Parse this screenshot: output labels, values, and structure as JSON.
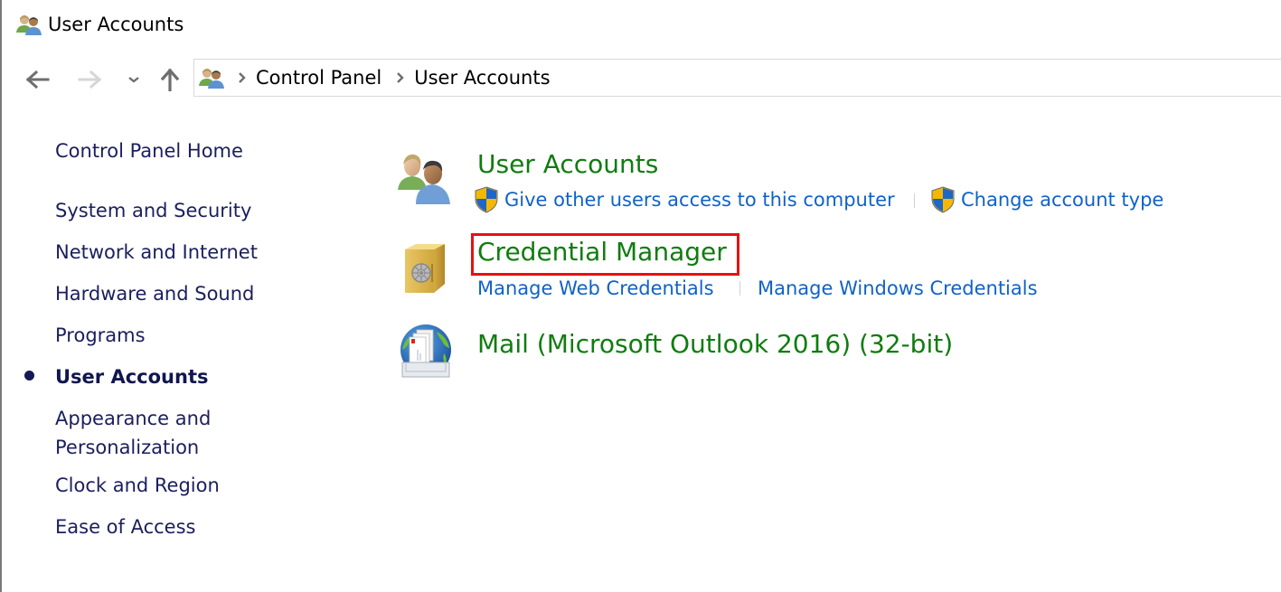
{
  "window": {
    "title": "User Accounts",
    "title_icon": "user-accounts-icon"
  },
  "navigation": {
    "back_icon": "arrow-left-icon",
    "forward_icon": "arrow-right-icon",
    "recent_icon": "chevron-down-icon",
    "up_icon": "arrow-up-icon",
    "back_enabled": true,
    "forward_enabled": false
  },
  "address_bar": {
    "icon": "user-accounts-icon",
    "breadcrumbs": [
      {
        "label": "Control Panel"
      },
      {
        "label": "User Accounts"
      }
    ]
  },
  "sidebar": {
    "home": "Control Panel Home",
    "items": [
      {
        "label": "System and Security",
        "current": false
      },
      {
        "label": "Network and Internet",
        "current": false
      },
      {
        "label": "Hardware and Sound",
        "current": false
      },
      {
        "label": "Programs",
        "current": false
      },
      {
        "label": "User Accounts",
        "current": true
      },
      {
        "label": "Appearance and",
        "label_line2": "Personalization",
        "current": false
      },
      {
        "label": "Clock and Region",
        "current": false
      },
      {
        "label": "Ease of Access",
        "current": false
      }
    ]
  },
  "categories": [
    {
      "title": "User Accounts",
      "icon": "user-accounts-icon",
      "tasks": [
        {
          "label": "Give other users access to this computer",
          "icon": "uac-shield-icon"
        },
        {
          "label": "Change account type",
          "icon": "uac-shield-icon"
        }
      ]
    },
    {
      "title": "Credential Manager",
      "icon": "safe-icon",
      "highlighted": true,
      "tasks": [
        {
          "label": "Manage Web Credentials"
        },
        {
          "label": "Manage Windows Credentials"
        }
      ]
    },
    {
      "title": "Mail (Microsoft Outlook 2016) (32-bit)",
      "icon": "mail-globe-icon",
      "tasks": []
    }
  ],
  "colors": {
    "category_title": "#107c10",
    "task_link": "#0f62c9",
    "sidebar_text": "#1a1f5e",
    "highlight_border": "#e81010"
  }
}
